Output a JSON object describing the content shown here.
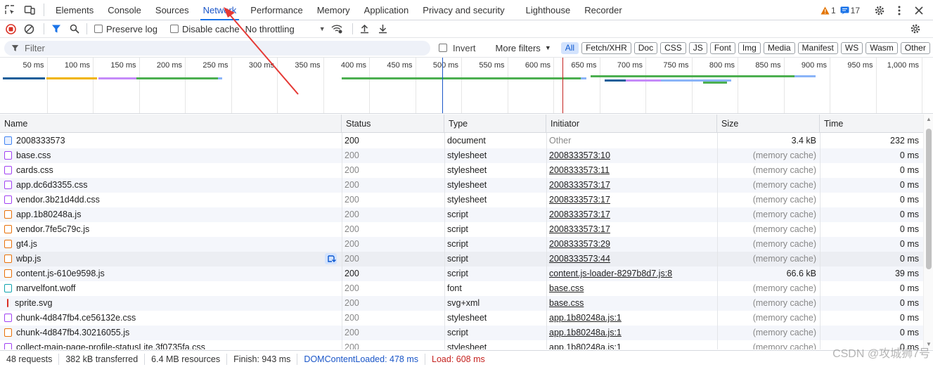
{
  "devtools": {
    "tabs": [
      {
        "label": "Elements"
      },
      {
        "label": "Console"
      },
      {
        "label": "Sources"
      },
      {
        "label": "Network",
        "active": true
      },
      {
        "label": "Performance"
      },
      {
        "label": "Memory"
      },
      {
        "label": "Application"
      },
      {
        "label": "Privacy and security"
      },
      {
        "label": "Lighthouse"
      },
      {
        "label": "Recorder"
      }
    ],
    "warning_count": "1",
    "message_count": "17"
  },
  "toolbar": {
    "preserve_log": "Preserve log",
    "disable_cache": "Disable cache",
    "throttling": "No throttling"
  },
  "filter": {
    "placeholder": "Filter",
    "invert": "Invert",
    "more_filters": "More filters",
    "types": [
      "All",
      "Fetch/XHR",
      "Doc",
      "CSS",
      "JS",
      "Font",
      "Img",
      "Media",
      "Manifest",
      "WS",
      "Wasm",
      "Other"
    ]
  },
  "overview": {
    "ticks": [
      "50 ms",
      "100 ms",
      "150 ms",
      "200 ms",
      "250 ms",
      "300 ms",
      "350 ms",
      "400 ms",
      "450 ms",
      "500 ms",
      "550 ms",
      "600 ms",
      "650 ms",
      "700 ms",
      "750 ms",
      "800 ms",
      "850 ms",
      "900 ms",
      "950 ms",
      "1,000 ms"
    ],
    "dom_content_loaded_ms": 478,
    "load_ms": 608
  },
  "table": {
    "headers": {
      "name": "Name",
      "status": "Status",
      "type": "Type",
      "initiator": "Initiator",
      "size": "Size",
      "time": "Time"
    },
    "rows": [
      {
        "name": "2008333573",
        "status": "200",
        "type": "document",
        "initiator": "Other",
        "size": "3.4 kB",
        "time": "232 ms",
        "kind": "doc"
      },
      {
        "name": "base.css",
        "status": "200",
        "type": "stylesheet",
        "initiator": "2008333573:10",
        "size": "(memory cache)",
        "time": "0 ms",
        "kind": "css"
      },
      {
        "name": "cards.css",
        "status": "200",
        "type": "stylesheet",
        "initiator": "2008333573:11",
        "size": "(memory cache)",
        "time": "0 ms",
        "kind": "css"
      },
      {
        "name": "app.dc6d3355.css",
        "status": "200",
        "type": "stylesheet",
        "initiator": "2008333573:17",
        "size": "(memory cache)",
        "time": "0 ms",
        "kind": "css"
      },
      {
        "name": "vendor.3b21d4dd.css",
        "status": "200",
        "type": "stylesheet",
        "initiator": "2008333573:17",
        "size": "(memory cache)",
        "time": "0 ms",
        "kind": "css"
      },
      {
        "name": "app.1b80248a.js",
        "status": "200",
        "type": "script",
        "initiator": "2008333573:17",
        "size": "(memory cache)",
        "time": "0 ms",
        "kind": "js"
      },
      {
        "name": "vendor.7fe5c79c.js",
        "status": "200",
        "type": "script",
        "initiator": "2008333573:17",
        "size": "(memory cache)",
        "time": "0 ms",
        "kind": "js"
      },
      {
        "name": "gt4.js",
        "status": "200",
        "type": "script",
        "initiator": "2008333573:29",
        "size": "(memory cache)",
        "time": "0 ms",
        "kind": "js"
      },
      {
        "name": "wbp.js",
        "status": "200",
        "type": "script",
        "initiator": "2008333573:44",
        "size": "(memory cache)",
        "time": "0 ms",
        "kind": "js"
      },
      {
        "name": "content.js-610e9598.js",
        "status": "200",
        "type": "script",
        "initiator": "content.js-loader-8297b8d7.js:8",
        "size": "66.6 kB",
        "time": "39 ms",
        "kind": "js"
      },
      {
        "name": "marvelfont.woff",
        "status": "200",
        "type": "font",
        "initiator": "base.css",
        "size": "(memory cache)",
        "time": "0 ms",
        "kind": "font"
      },
      {
        "name": "sprite.svg",
        "status": "200",
        "type": "svg+xml",
        "initiator": "base.css",
        "size": "(memory cache)",
        "time": "0 ms",
        "kind": "svg"
      },
      {
        "name": "chunk-4d847fb4.ce56132e.css",
        "status": "200",
        "type": "stylesheet",
        "initiator": "app.1b80248a.js:1",
        "size": "(memory cache)",
        "time": "0 ms",
        "kind": "css"
      },
      {
        "name": "chunk-4d847fb4.30216055.js",
        "status": "200",
        "type": "script",
        "initiator": "app.1b80248a.js:1",
        "size": "(memory cache)",
        "time": "0 ms",
        "kind": "js"
      },
      {
        "name": "collect-main-page-profile-statusLite.3f0735fa.css",
        "status": "200",
        "type": "stylesheet",
        "initiator": "app.1b80248a.js:1",
        "size": "(memory cache)",
        "time": "0 ms",
        "kind": "css"
      }
    ]
  },
  "status_bar": {
    "requests": "48 requests",
    "transferred": "382 kB transferred",
    "resources": "6.4 MB resources",
    "finish": "Finish: 943 ms",
    "dom_content_loaded": "DOMContentLoaded: 478 ms",
    "load": "Load: 608 ms"
  },
  "watermark": "CSDN @攻城狮7号",
  "colors": {
    "accent": "#1a73e8",
    "record_red": "#d93025",
    "dcl_line": "#1a56c8",
    "load_line": "#c5221f",
    "css_icon": "#a142f4",
    "js_icon": "#e8710a",
    "doc_icon": "#4285f4",
    "font_icon": "#12a4af"
  }
}
